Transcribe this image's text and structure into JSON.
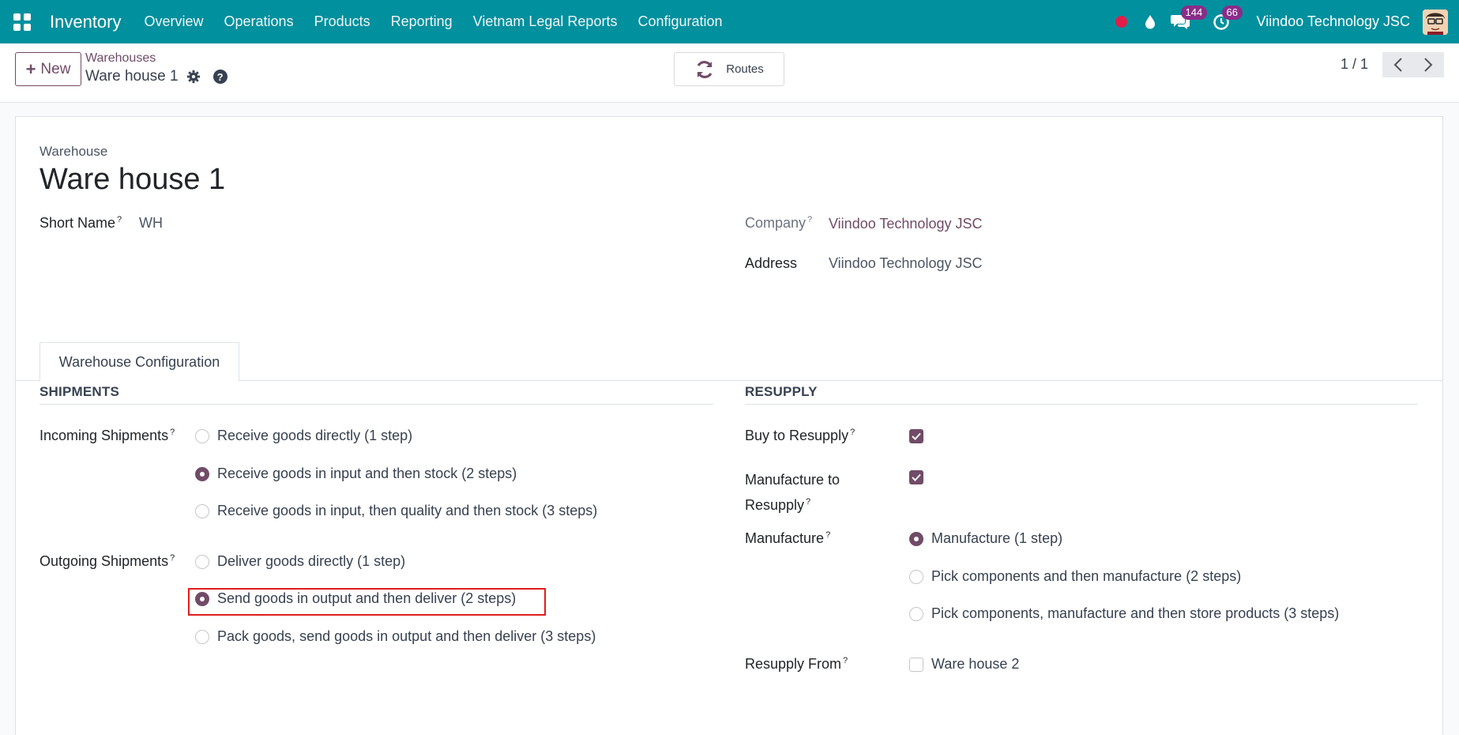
{
  "topbar": {
    "app_name": "Inventory",
    "menu": [
      "Overview",
      "Operations",
      "Products",
      "Reporting",
      "Vietnam Legal Reports",
      "Configuration"
    ],
    "messages_count": "144",
    "activities_count": "66",
    "company": "Viindoo Technology JSC",
    "accent": "#00909e"
  },
  "control": {
    "new_label": "New",
    "breadcrumb_parent": "Warehouses",
    "breadcrumb_current": "Ware house 1",
    "routes_label": "Routes",
    "pager": "1 / 1"
  },
  "form": {
    "model_label": "Warehouse",
    "name": "Ware house 1",
    "short_name_label": "Short Name",
    "short_name": "WH",
    "company_label": "Company",
    "company": "Viindoo Technology JSC",
    "address_label": "Address",
    "address": "Viindoo Technology JSC",
    "tab_label": "Warehouse Configuration",
    "shipments": {
      "title": "SHIPMENTS",
      "incoming_label": "Incoming Shipments",
      "incoming_options": [
        "Receive goods directly (1 step)",
        "Receive goods in input and then stock (2 steps)",
        "Receive goods in input, then quality and then stock (3 steps)"
      ],
      "incoming_selected": 1,
      "outgoing_label": "Outgoing Shipments",
      "outgoing_options": [
        "Deliver goods directly (1 step)",
        "Send goods in output and then deliver (2 steps)",
        "Pack goods, send goods in output and then deliver (3 steps)"
      ],
      "outgoing_selected": 1
    },
    "resupply": {
      "title": "RESUPPLY",
      "buy_label": "Buy to Resupply",
      "buy_checked": true,
      "manufacture_resupply_label_1": "Manufacture to",
      "manufacture_resupply_label_2": "Resupply",
      "manufacture_resupply_checked": true,
      "manufacture_label": "Manufacture",
      "manufacture_options": [
        "Manufacture (1 step)",
        "Pick components and then manufacture (2 steps)",
        "Pick components, manufacture and then store products (3 steps)"
      ],
      "manufacture_selected": 0,
      "resupply_from_label": "Resupply From",
      "resupply_from_option": "Ware house 2",
      "resupply_from_checked": false
    },
    "help_mark": "?"
  }
}
